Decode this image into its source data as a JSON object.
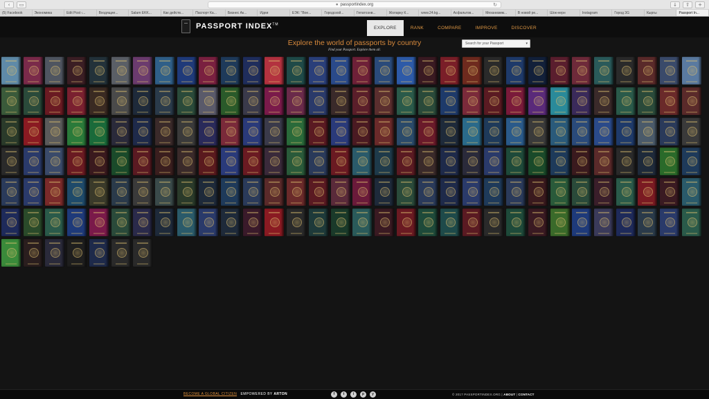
{
  "browser": {
    "url": "passportindex.org",
    "tabs": [
      "(5) Facebook",
      "Экономика",
      "Edit Post ‹...",
      "Входящие...",
      "Salam EKK...",
      "Как действ...",
      "Паспорт Ка...",
      "Бизнес Ак...",
      "Идеи",
      "ЕЭК: \"Вое...",
      "Городской...",
      "Гепатоэнв...",
      "Жоларкy К...",
      "www.24.kg...",
      "Асфальтов...",
      "Механизмм...",
      "В новой ре...",
      "Шок-нерн",
      "Instagram",
      "Город 3G",
      "Кыргы",
      "Passport In..."
    ],
    "active_tab_index": 21
  },
  "header": {
    "logo_text": "PASSPORT INDEX",
    "logo_mark": "TM",
    "nav": [
      {
        "label": "EXPLORE",
        "active": true
      },
      {
        "label": "RANK",
        "active": false
      },
      {
        "label": "COMPARE",
        "active": false
      },
      {
        "label": "IMPROVE",
        "active": false
      },
      {
        "label": "DISCOVER",
        "active": false
      }
    ]
  },
  "hero": {
    "title": "Explore the world of passports by country",
    "subtitle": "Find your Passport. Explore them all."
  },
  "search": {
    "placeholder": "Search for your Passport"
  },
  "passports": {
    "rows": [
      [
        "#5f8aa8",
        "#7a2a4a",
        "#4f5560",
        "#3b1e24",
        "#23323a",
        "#5a5f66",
        "#6b3b6e",
        "#2f5f88",
        "#1f3a7a",
        "#7a2040",
        "#1e3a5a",
        "#1f2d5c",
        "#b3323f",
        "#1f4a48",
        "#2a3f7a",
        "#2a4a8a",
        "#6e2038",
        "#2a4a7a",
        "#2d5aa8",
        "#3a1a22",
        "#7a1e28",
        "#6e2a1e",
        "#2a2a2a",
        "#1e3a6a",
        "#12203a",
        "#5a1e2e",
        "#6e2a3a",
        "#2a5a5a",
        "#2a2a2a",
        "#5a2a2a",
        "#3a4a6a",
        "#5a7aa0"
      ],
      [
        "#3a5a3a",
        "#2a4a3a",
        "#6a1a22",
        "#7a2030",
        "#3a2a22",
        "#4a4a4a",
        "#1e2a3a",
        "#2a3a4a",
        "#2a4a3a",
        "#5a5a6a",
        "#2a5a2a",
        "#3a3a4a",
        "#7a1a4a",
        "#6a2a4a",
        "#2a3a6a",
        "#3a2a2a",
        "#5a1e2a",
        "#5a2e2e",
        "#2a5a4a",
        "#2a4a3a",
        "#1e3a6a",
        "#7a2a3a",
        "#5a1a22",
        "#7a1a3a",
        "#5a2a7a",
        "#2a8a9a",
        "#3a2a5a",
        "#3a2a2a",
        "#2a5a4a",
        "#2a4a3a",
        "#6a2a2a",
        "#5a2a2a"
      ],
      [
        "#2a3a2a",
        "#8a1a22",
        "#5a5a5a",
        "#2a7a3a",
        "#1a6a3a",
        "#2a2a3a",
        "#1e2a4a",
        "#3a2a2a",
        "#3a3a3a",
        "#2a2a5a",
        "#7a2a3a",
        "#2a3a7a",
        "#3a3a4a",
        "#2a6a3a",
        "#5a1a22",
        "#2a3a7a",
        "#4a1a22",
        "#6a2a2a",
        "#2a4a6a",
        "#6a1a2a",
        "#1e2a3a",
        "#2a6a8a",
        "#1e3a5a",
        "#2a5a8a",
        "#3a3a3a",
        "#2a5a7a",
        "#2a4a7a",
        "#2a4a8a",
        "#1e3a6a",
        "#4a5a6a",
        "#2a3a5a",
        "#3a3a3a"
      ],
      [
        "#2a2a2a",
        "#2a3a6a",
        "#3a4a6a",
        "#6a1a22",
        "#3a1a1e",
        "#1a4a2a",
        "#5a1a22",
        "#3a1e1e",
        "#3a2a2a",
        "#5a1a1e",
        "#2a3a7a",
        "#6a1a22",
        "#3a2a3a",
        "#2a5a3a",
        "#2a3a5a",
        "#6a1a22",
        "#2a5a6a",
        "#1e3a4a",
        "#5a1a22",
        "#3a2a2a",
        "#1e2a4a",
        "#2a2a3a",
        "#2a3a6a",
        "#1e4a3a",
        "#1a4a2a",
        "#1e3a5a",
        "#3a1a1e",
        "#5a2a2a",
        "#2a2a2a",
        "#1e2a3a",
        "#2a6a2a",
        "#1e3a5a"
      ],
      [
        "#2a3a5a",
        "#2a3a6a",
        "#7a2a2a",
        "#1e4a6a",
        "#3a3a2a",
        "#2a3a4a",
        "#3a3a3a",
        "#3a4a4a",
        "#2a3a2a",
        "#1e2a3a",
        "#1e3a5a",
        "#2a3a5a",
        "#5a2a2a",
        "#6a2a2a",
        "#5a1a22",
        "#5a2a3a",
        "#6a1a3a",
        "#1e2a3a",
        "#2a4a3a",
        "#2a3a5a",
        "#1e2a4a",
        "#2a3a6a",
        "#1e3a5a",
        "#2a3a5a",
        "#3a1a1e",
        "#2a5a3a",
        "#2a4a3a",
        "#3a1e2a",
        "#2a5a4a",
        "#7a1a22",
        "#3a1a22",
        "#2a5a6a"
      ],
      [
        "#1e2a5a",
        "#2a4a2a",
        "#2a5a4a",
        "#1e3a7a",
        "#7a1a4a",
        "#2a4a3a",
        "#2a2a4a",
        "#1e2a3a",
        "#2a5a6a",
        "#2a3a6a",
        "#1e2a3a",
        "#3a1a2a",
        "#8a1a22",
        "#2a2a2a",
        "#1e3a3a",
        "#1a3a2a",
        "#2a5a5a",
        "#3a1a22",
        "#6a1a22",
        "#1e4a3a",
        "#1e4a4a",
        "#5a1a22",
        "#2a2a2a",
        "#1e4a3a",
        "#3a1a22",
        "#3a6a2a",
        "#1e3a7a",
        "#3a3a5a",
        "#1e2a5a",
        "#2a3a4a",
        "#2a3a6a",
        "#2a5a4a"
      ],
      [
        "#3a8a3a",
        "#2a1e1e",
        "#2a2a3a",
        "#1e1e1e",
        "#1e2a4a",
        "#2a2a2a",
        "#2a2a2a"
      ]
    ]
  },
  "footer": {
    "become": "BECOME A GLOBAL CITIZEN",
    "powered": "EMPOWERED BY",
    "powered_brand": "ARTON",
    "social": [
      "f",
      "t",
      "i",
      "p",
      "y"
    ],
    "copyright": "© 2017 PASSPORTINDEX.ORG",
    "about": "ABOUT",
    "contact": "CONTACT"
  }
}
